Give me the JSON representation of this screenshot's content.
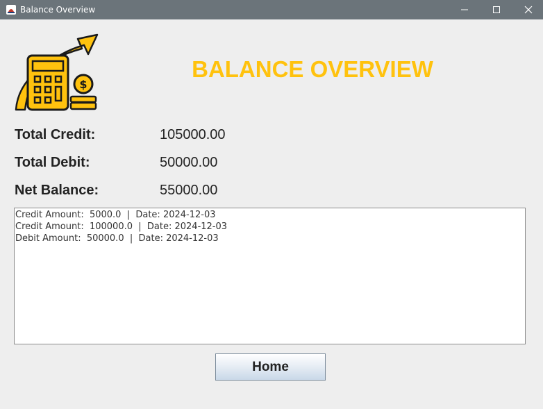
{
  "window": {
    "title": "Balance Overview"
  },
  "header": {
    "title": "BALANCE OVERVIEW"
  },
  "summary": [
    {
      "label": "Total Credit:",
      "value": "105000.00"
    },
    {
      "label": "Total Debit:",
      "value": "50000.00"
    },
    {
      "label": "Net Balance:",
      "value": "55000.00"
    }
  ],
  "transactions": [
    "Credit Amount:  5000.0  |  Date: 2024-12-03",
    "Credit Amount:  100000.0  |  Date: 2024-12-03",
    "Debit Amount:  50000.0  |  Date: 2024-12-03"
  ],
  "buttons": {
    "home": "Home"
  },
  "colors": {
    "accent": "#ffc20e",
    "titlebar": "#6b747a",
    "icon_outline": "#1a1a1a"
  },
  "icons": {
    "app": "java-cup-icon",
    "logo": "calculator-growth-icon"
  }
}
